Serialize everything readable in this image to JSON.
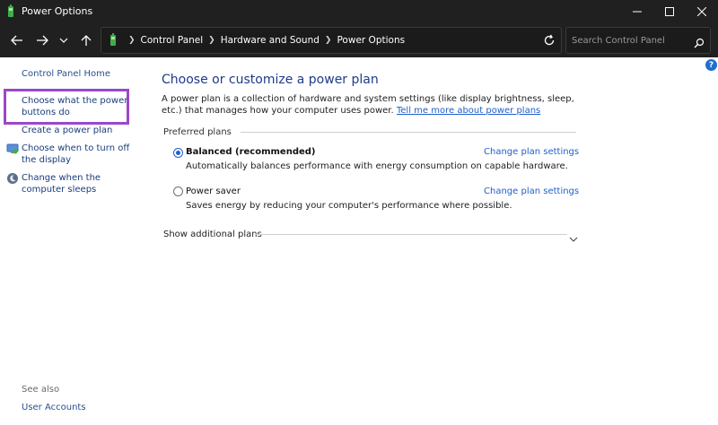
{
  "window": {
    "title": "Power Options"
  },
  "address_bar": {
    "breadcrumbs": [
      "Control Panel",
      "Hardware and Sound",
      "Power Options"
    ],
    "search_placeholder": "Search Control Panel"
  },
  "sidebar": {
    "home": "Control Panel Home",
    "links": [
      "Choose what the power buttons do",
      "Create a power plan",
      "Choose when to turn off the display",
      "Change when the computer sleeps"
    ],
    "see_also_label": "See also",
    "see_also_links": [
      "User Accounts"
    ],
    "highlight_color": "#9b47c9"
  },
  "main": {
    "help_label": "?",
    "title": "Choose or customize a power plan",
    "description": "A power plan is a collection of hardware and system settings (like display brightness, sleep, etc.) that manages how your computer uses power.",
    "description_link": "Tell me more about power plans",
    "preferred_label": "Preferred plans",
    "plans": [
      {
        "name": "Balanced (recommended)",
        "selected": true,
        "description": "Automatically balances performance with energy consumption on capable hardware.",
        "link": "Change plan settings"
      },
      {
        "name": "Power saver",
        "selected": false,
        "description": "Saves energy by reducing your computer's performance where possible.",
        "link": "Change plan settings"
      }
    ],
    "show_additional": "Show additional plans"
  },
  "colors": {
    "titlebar_bg": "#202020",
    "link": "#1f5fcc",
    "heading": "#1d3b8a"
  }
}
